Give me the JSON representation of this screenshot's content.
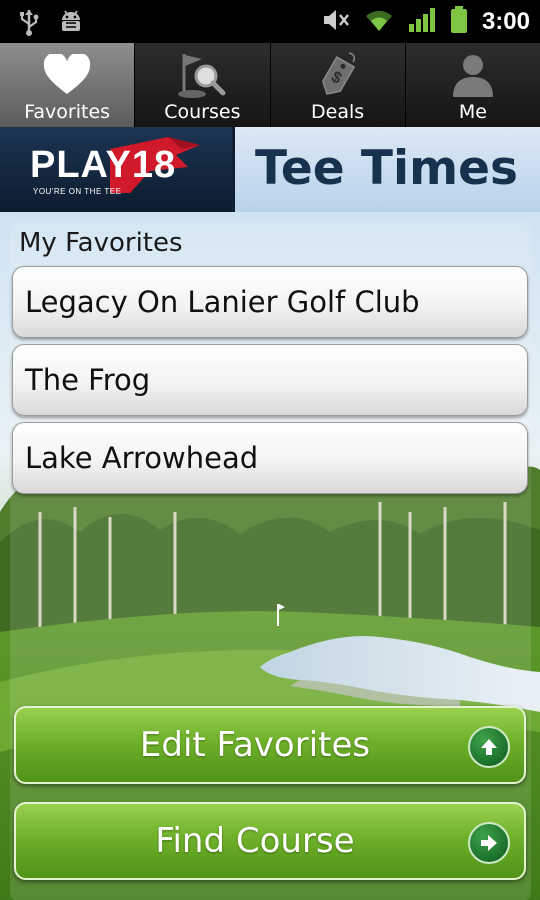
{
  "status_bar": {
    "time": "3:00",
    "icons": [
      "usb-icon",
      "android-debug-icon",
      "mute-icon",
      "wifi-icon",
      "signal-icon",
      "battery-icon"
    ]
  },
  "tabs": [
    {
      "label": "Favorites",
      "icon": "heart-icon",
      "active": true
    },
    {
      "label": "Courses",
      "icon": "golf-search-icon",
      "active": false
    },
    {
      "label": "Deals",
      "icon": "price-tag-icon",
      "active": false
    },
    {
      "label": "Me",
      "icon": "person-icon",
      "active": false
    }
  ],
  "brand": {
    "logo_text": "PLAY18",
    "logo_tagline": "YOU'RE ON THE TEE",
    "title": "Tee Times"
  },
  "favorites": {
    "section_title": "My Favorites",
    "items": [
      "Legacy On Lanier Golf Club",
      "The Frog",
      "Lake Arrowhead"
    ]
  },
  "actions": {
    "edit_favorites": {
      "label": "Edit Favorites",
      "icon": "arrow-up-icon"
    },
    "find_course": {
      "label": "Find Course",
      "icon": "arrow-right-icon"
    }
  },
  "colors": {
    "accent_green": "#6fb12a",
    "brand_navy": "#12243a",
    "title_blue": "#17324f",
    "logo_red": "#d0192b"
  }
}
